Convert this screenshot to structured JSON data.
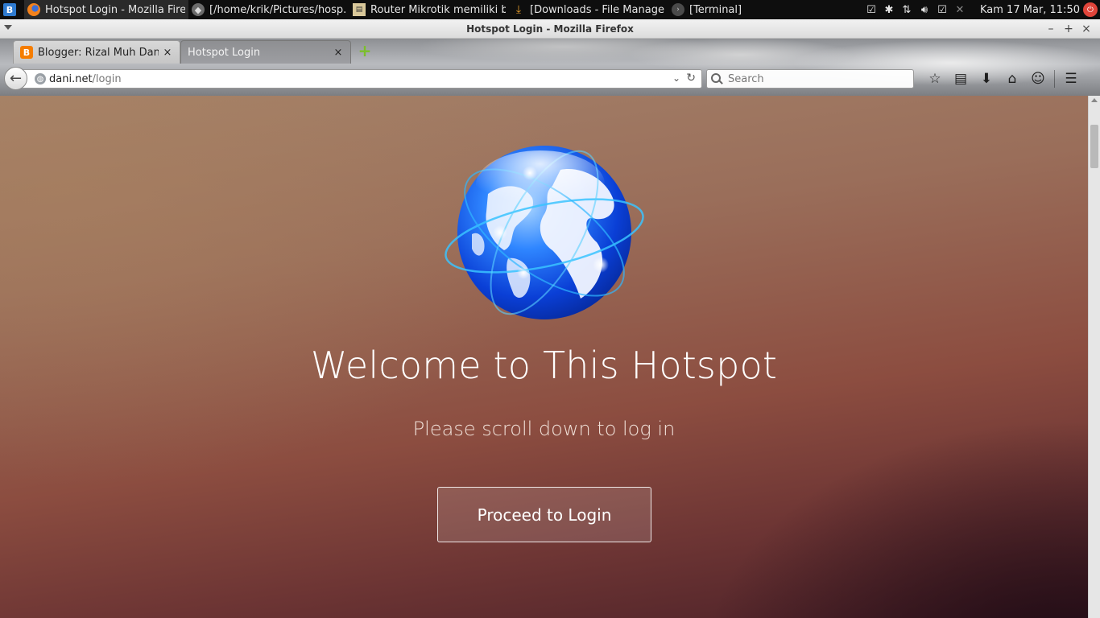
{
  "taskbar": {
    "apps": [
      {
        "title": "Hotspot Login - Mozilla Fire...",
        "icon": "firefox-icon",
        "active": true
      },
      {
        "title": "[/home/krik/Pictures/hosp...",
        "icon": "image-viewer-icon",
        "active": false
      },
      {
        "title": "Router Mikrotik memiliki ba...",
        "icon": "document-icon",
        "active": false
      },
      {
        "title": "[Downloads - File Manager]",
        "icon": "download-folder-icon",
        "active": false
      },
      {
        "title": "[Terminal]",
        "icon": "terminal-icon",
        "active": false
      }
    ],
    "clock": "Kam 17 Mar, 11:50"
  },
  "window": {
    "title": "Hotspot Login - Mozilla Firefox"
  },
  "tabs": [
    {
      "label": "Blogger: Rizal Muh Dani...",
      "close": "×"
    },
    {
      "label": "Hotspot Login",
      "close": "×"
    }
  ],
  "new_tab": "+",
  "urlbar": {
    "host": "dani.net",
    "path": "/login"
  },
  "search": {
    "placeholder": "Search"
  },
  "page": {
    "welcome": "Welcome to This Hotspot",
    "subtitle": "Please scroll down to log in",
    "proceed_label": "Proceed to Login"
  },
  "colors": {
    "accent_new_tab": "#7bbf2a",
    "blogger_orange": "#f57d00",
    "page_top": "#a4826a",
    "page_bottom": "#4a2027"
  }
}
